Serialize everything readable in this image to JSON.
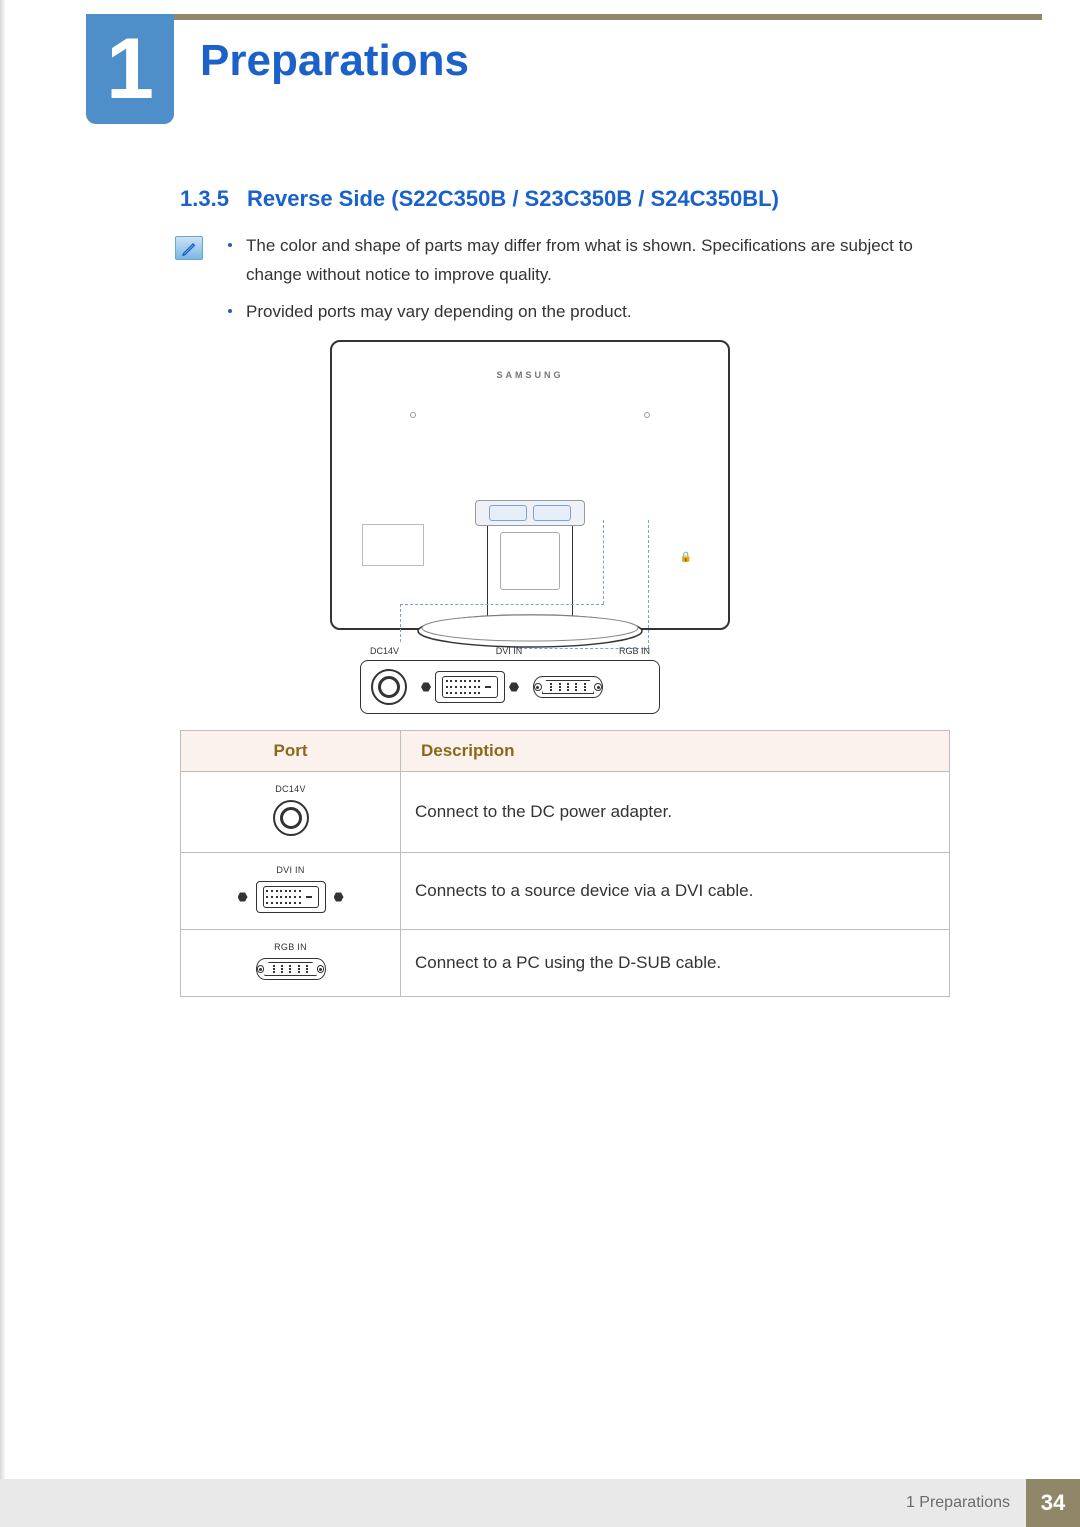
{
  "chapter": {
    "number": "1",
    "title": "Preparations"
  },
  "section": {
    "number": "1.3.5",
    "title": "Reverse Side (S22C350B / S23C350B / S24C350BL)"
  },
  "bullets": [
    "The color and shape of parts may differ from what is shown. Specifications are subject to change without notice to improve quality.",
    "Provided ports may vary depending on the product."
  ],
  "diagram": {
    "brand": "SAMSUNG",
    "port_labels": {
      "dc": "DC14V",
      "dvi": "DVI IN",
      "rgb": "RGB IN"
    }
  },
  "table": {
    "headers": {
      "port": "Port",
      "description": "Description"
    },
    "rows": [
      {
        "label": "DC14V",
        "icon": "dc-port-icon",
        "description": "Connect to the DC power adapter."
      },
      {
        "label": "DVI IN",
        "icon": "dvi-port-icon",
        "description": "Connects to a source device via a DVI cable."
      },
      {
        "label": "RGB IN",
        "icon": "rgb-port-icon",
        "description": "Connect to a PC using the D-SUB cable."
      }
    ]
  },
  "footer": {
    "label": "1 Preparations",
    "page": "34"
  }
}
